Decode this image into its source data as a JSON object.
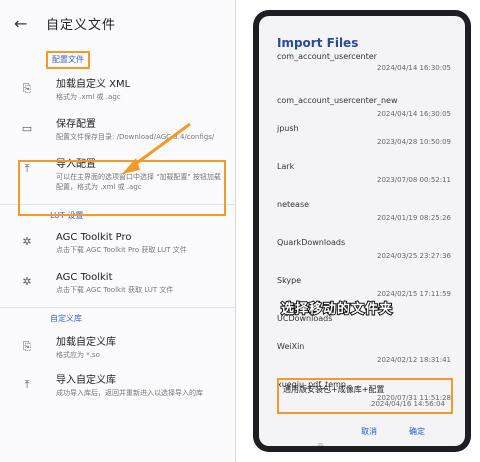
{
  "left": {
    "title": "自定义文件",
    "back_icon": "arrow-left-icon",
    "section_config": "配置文件",
    "items_config": [
      {
        "title": "加载自定义 XML",
        "subtitle": "格式为 .xml 或 .agc",
        "icon": "file-import-icon"
      },
      {
        "title": "保存配置",
        "subtitle": "配置文件保存目录: /Download/AGC.8.4/configs/",
        "icon": "keyboard-icon"
      },
      {
        "title": "导入配置",
        "subtitle": "可以在主界面的选项窗口中选择 \"加载配置\" 按钮加载配置，格式为 .xml 或 .agc",
        "icon": "upload-icon"
      }
    ],
    "section_lut": "LUT 设置",
    "items_lut": [
      {
        "title": "AGC Toolkit Pro",
        "subtitle": "点击下载 AGC Toolkit Pro 获取 LUT 文件",
        "icon": "atom-icon"
      },
      {
        "title": "AGC Toolkit",
        "subtitle": "点击下载 AGC Toolkit 获取 LUT 文件",
        "icon": "atom-icon"
      }
    ],
    "section_lib": "自定义库",
    "items_lib": [
      {
        "title": "加载自定义库",
        "subtitle": "格式应为 *.so",
        "icon": "file-import-icon"
      },
      {
        "title": "导入自定义库",
        "subtitle": "成功导入库后，返回并重新进入以选择导入的库",
        "icon": "upload-icon"
      }
    ]
  },
  "right": {
    "dialog_title": "Import Files",
    "files": [
      {
        "name": "com_account_usercenter",
        "date": "2024/04/14 16:30:05"
      },
      {
        "name": "com_account_usercenter_new",
        "date": "2024/04/14 16:30:05"
      },
      {
        "name": "jpush",
        "date": "2023/04/28 10:50:09"
      },
      {
        "name": "Lark",
        "date": "2023/07/08 00:52:11"
      },
      {
        "name": "netease",
        "date": "2024/01/19 08:25:26"
      },
      {
        "name": "QuarkDownloads",
        "date": "2024/03/25 23:27:36"
      },
      {
        "name": "Skype",
        "date": "2024/02/15 17:11:59"
      },
      {
        "name": "UCDownloads",
        "date": ""
      },
      {
        "name": "WeiXin",
        "date": "2024/02/12 18:31:41"
      },
      {
        "name": "xueqiu_pdf_temp",
        "date": "2020/07/31 11:51:28"
      }
    ],
    "overlay_text": "选择移动的文件夹",
    "target_file": {
      "name": "通用版安装包+成像库+配置",
      "date": "2024/04/16 14:56:04"
    },
    "cancel_label": "取消",
    "ok_label": "确定",
    "below_text": "斋"
  },
  "colors": {
    "accent": "#f39a2a",
    "link": "#3f63c8"
  }
}
